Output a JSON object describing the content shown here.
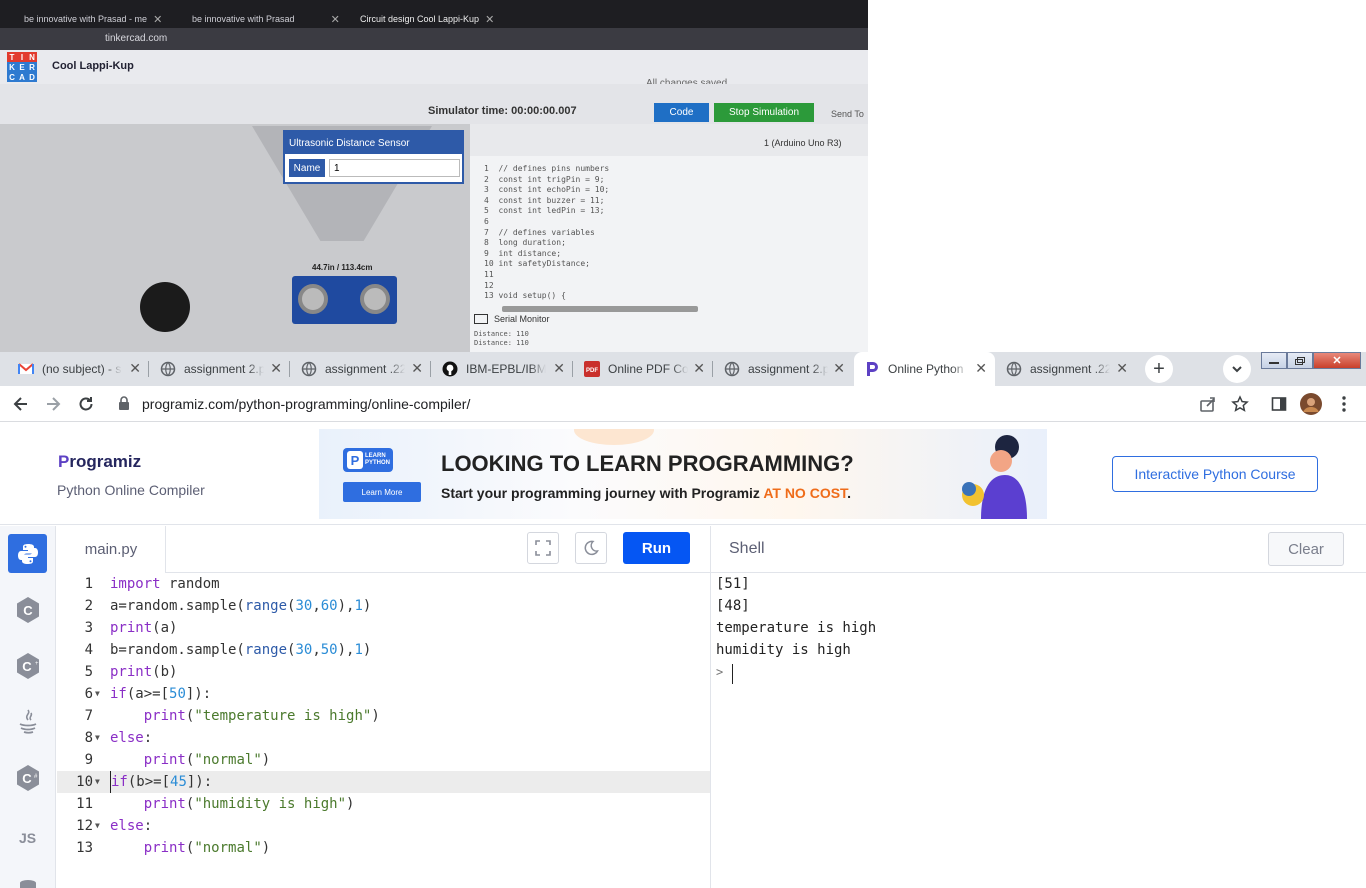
{
  "photo": {
    "tabs": [
      "be innovative with Prasad - me",
      "be innovative with Prasad",
      "Circuit design Cool Lappi-Kup"
    ],
    "url": "tinkercad.com",
    "project": "Cool Lappi-Kup",
    "saved": "All changes saved",
    "sim_time": "Simulator time: 00:00:00.007",
    "code_btn": "Code",
    "stop_btn": "Stop Simulation",
    "send_to": "Send To",
    "popup_title": "Ultrasonic Distance Sensor",
    "popup_name_label": "Name",
    "popup_name_value": "1",
    "distance_label": "44.7in / 113.4cm",
    "board_select": "1 (Arduino Uno R3)",
    "code_lines": [
      "1  // defines pins numbers",
      "2  const int trigPin = 9;",
      "3  const int echoPin = 10;",
      "4  const int buzzer = 11;",
      "5  const int ledPin = 13;",
      "6",
      "7  // defines variables",
      "8  long duration;",
      "9  int distance;",
      "10 int safetyDistance;",
      "11",
      "12",
      "13 void setup() {"
    ],
    "serial_monitor": "Serial Monitor",
    "serial_output": [
      "Distance: 110",
      "Distance: 110"
    ]
  },
  "browser": {
    "tabs": [
      {
        "label": "(no subject) - s",
        "icon": "gmail-icon",
        "color": "#ea4335"
      },
      {
        "label": "assignment 2.p",
        "icon": "globe-icon",
        "color": "#5f6368"
      },
      {
        "label": "assignment .22",
        "icon": "globe-icon",
        "color": "#5f6368"
      },
      {
        "label": "IBM-EPBL/IBM",
        "icon": "github-icon",
        "color": "#111111"
      },
      {
        "label": "Online PDF Co",
        "icon": "pdf-icon",
        "color": "#c9302c"
      },
      {
        "label": "assignment 2.p",
        "icon": "globe-icon",
        "color": "#5f6368"
      },
      {
        "label": "Online Python",
        "icon": "programiz-icon",
        "color": "#5d41c4"
      },
      {
        "label": "assignment .22",
        "icon": "globe-icon",
        "color": "#5f6368"
      }
    ],
    "url": "programiz.com/python-programming/online-compiler/"
  },
  "header": {
    "brand": "rogramiz",
    "brand_initial": "P",
    "subtitle": "Python Online Compiler",
    "course_button": "Interactive Python Course"
  },
  "ad": {
    "logo_text_1": "LEARN",
    "logo_text_2": "PYTHON",
    "learn_more": "Learn More",
    "headline": "LOOKING TO LEARN PROGRAMMING?",
    "sub_text": "Start your programming journey with Programiz ",
    "sub_highlight": "AT NO COST",
    "sub_end": "."
  },
  "sidebar": {
    "languages": [
      "python-icon",
      "c-icon",
      "cpp-icon",
      "java-icon",
      "csharp-icon",
      "js-icon",
      "sql-icon"
    ],
    "js_label": "JS"
  },
  "editor": {
    "filename": "main.py",
    "run_label": "Run",
    "current_line": 10
  },
  "shell": {
    "title": "Shell",
    "clear_label": "Clear",
    "output": [
      "[51]",
      "[48]",
      "temperature is high",
      "humidity is high"
    ],
    "prompt": ">"
  },
  "colors": {
    "accent": "#0556f3",
    "brand": "#5d41c4"
  }
}
